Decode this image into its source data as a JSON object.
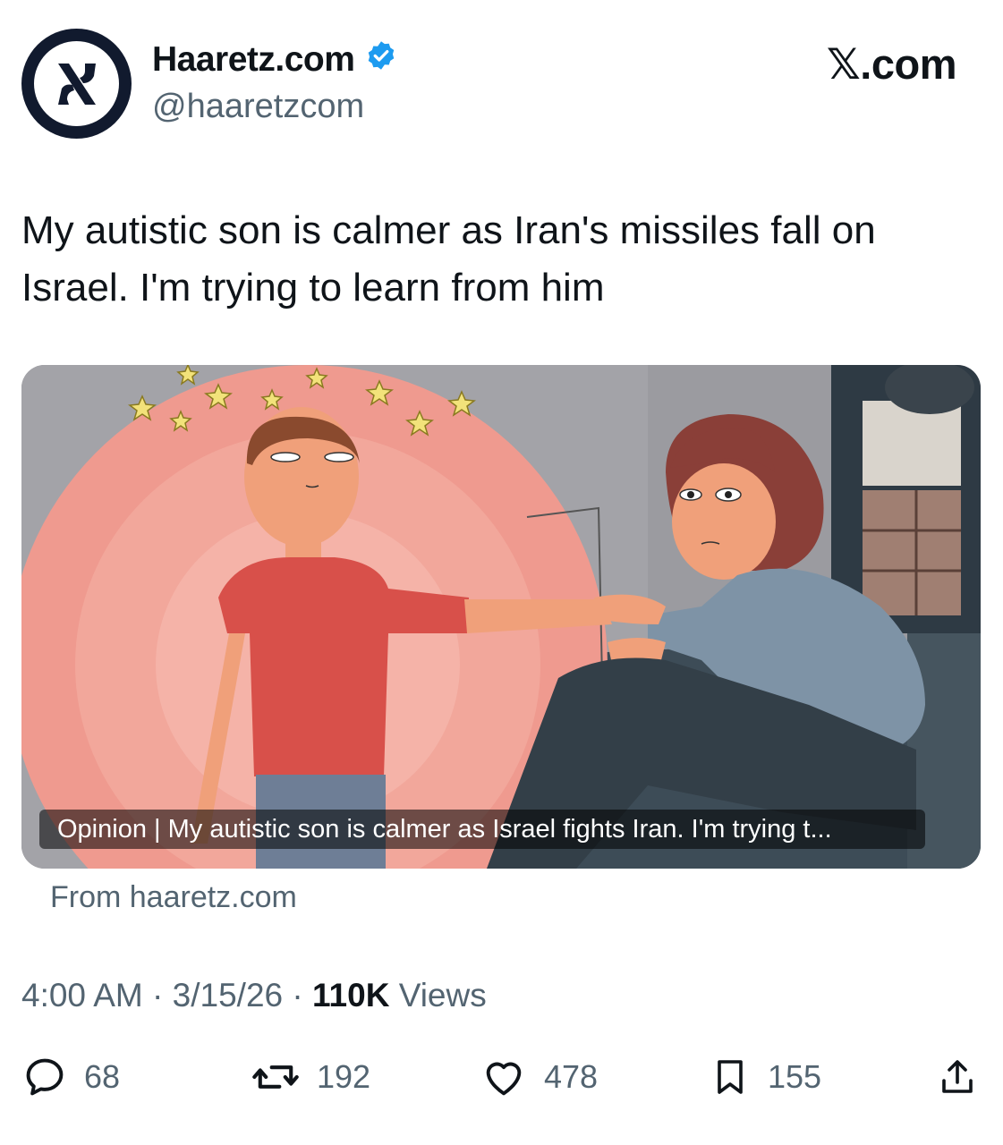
{
  "account": {
    "display_name": "Haaretz.com",
    "handle": "@haaretzcom",
    "verified": true
  },
  "watermark": "𝕏.com",
  "tweet": {
    "text": "My autistic son is calmer as Iran's missiles fall on Israel. I'm trying to learn from him"
  },
  "card": {
    "caption": "Opinion | My autistic son is calmer as Israel fights Iran. I'm trying t...",
    "from": "From haaretz.com"
  },
  "meta": {
    "time": "4:00 AM",
    "sep1": " · ",
    "date": "3/15/26",
    "sep2": " · ",
    "views_count": "110K",
    "views_label": " Views"
  },
  "actions": {
    "replies": "68",
    "reposts": "192",
    "likes": "478",
    "bookmarks": "155"
  },
  "colors": {
    "verified_badge": "#1d9bf0",
    "muted_text": "#536471",
    "avatar_ring": "#111a2e"
  }
}
